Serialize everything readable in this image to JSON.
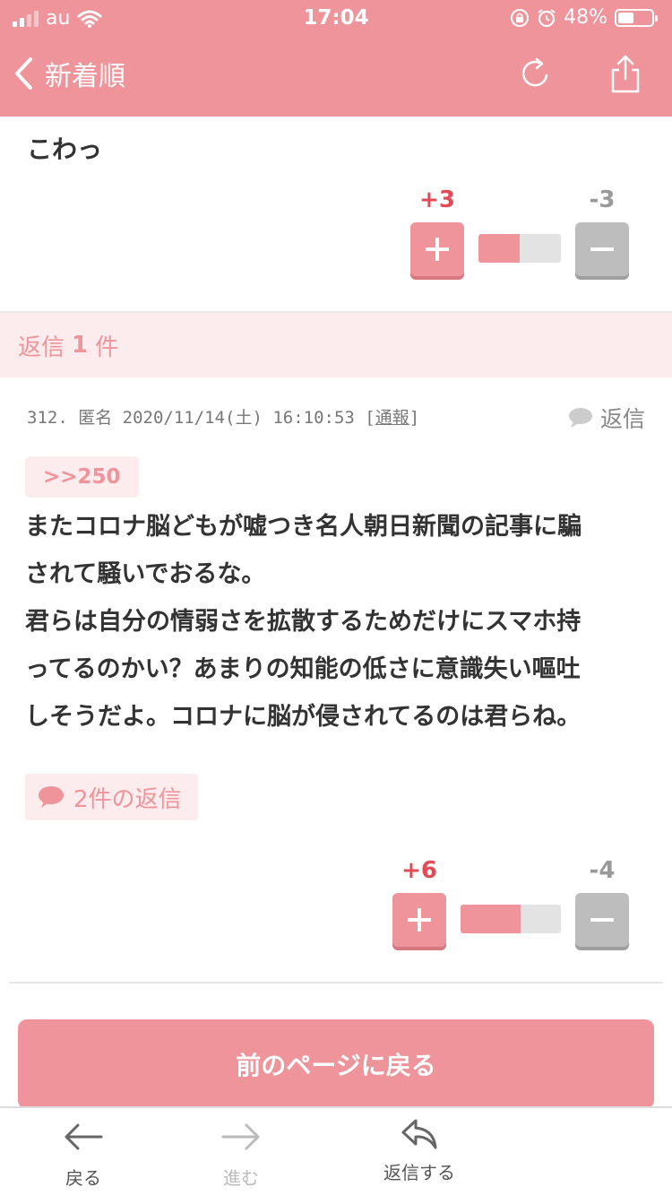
{
  "status_bar": {
    "carrier": "au",
    "time": "17:04",
    "battery": "48%",
    "battery_level": 0.48
  },
  "header": {
    "title": "新着順"
  },
  "top_post": {
    "text": "こわっ",
    "plus": "+3",
    "minus": "-3",
    "plus_ratio": 0.5
  },
  "replies_header": {
    "prefix": "返信",
    "count": "1",
    "suffix": "件"
  },
  "comment": {
    "meta_prefix": "312. 匿名 2020/11/14(土) 16:10:53 [",
    "report_label": "通報",
    "meta_suffix": "]",
    "reply_label": "返信",
    "anchor": ">>250",
    "lines": [
      "またコロナ脳どもが嘘つき名人朝日新聞の記事に騙",
      "されて騒いでおるな。",
      "君らは自分の情弱さを拡散するためだけにスマホ持",
      "ってるのかい？あまりの知能の低さに意識失い嘔吐",
      "しそうだよ。コロナに脳が侵されてるのは君らね。"
    ],
    "thread_label": "2件の返信",
    "plus": "+6",
    "minus": "-4",
    "plus_ratio": 0.6
  },
  "prev_page_button": "前のページに戻る",
  "tabbar": {
    "back": "戻る",
    "forward": "進む",
    "reply": "返信する"
  },
  "colors": {
    "accent": "#ef949a",
    "plus_text": "#e34a55",
    "minus_button": "#bdbdbd"
  }
}
